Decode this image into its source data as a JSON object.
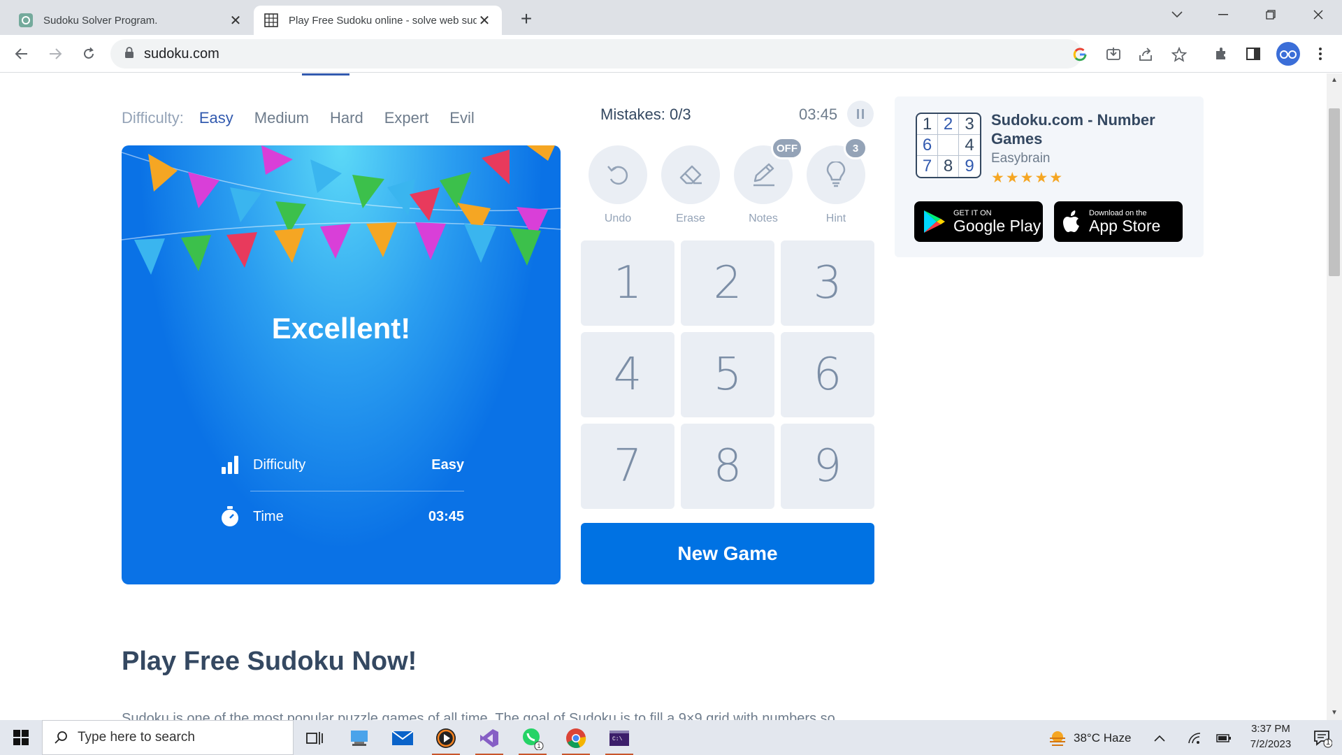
{
  "browser": {
    "tabs": [
      {
        "title": "Sudoku Solver Program.",
        "active": false
      },
      {
        "title": "Play Free Sudoku online - solve web sudoku puzzles",
        "active": true
      }
    ],
    "url": "sudoku.com"
  },
  "game": {
    "difficulty_label": "Difficulty:",
    "difficulty_options": [
      "Easy",
      "Medium",
      "Hard",
      "Expert",
      "Evil"
    ],
    "active_difficulty": "Easy",
    "mistakes": "Mistakes: 0/3",
    "timer": "03:45",
    "result": {
      "title": "Excellent!",
      "stats": [
        {
          "label": "Difficulty",
          "value": "Easy"
        },
        {
          "label": "Time",
          "value": "03:45"
        }
      ]
    },
    "tools": [
      {
        "label": "Undo",
        "badge": ""
      },
      {
        "label": "Erase",
        "badge": ""
      },
      {
        "label": "Notes",
        "badge": "OFF"
      },
      {
        "label": "Hint",
        "badge": "3"
      }
    ],
    "numbers": [
      "1",
      "2",
      "3",
      "4",
      "5",
      "6",
      "7",
      "8",
      "9"
    ],
    "new_game_label": "New Game"
  },
  "promo": {
    "grid": [
      "1",
      "2",
      "3",
      "6",
      "",
      "4",
      "7",
      "8",
      "9"
    ],
    "title": "Sudoku.com - Number Games",
    "developer": "Easybrain",
    "rating": 4.5,
    "stars": "★★★★★",
    "google_play": {
      "small": "GET IT ON",
      "big": "Google Play"
    },
    "app_store": {
      "small": "Download on the",
      "big": "App Store"
    }
  },
  "content": {
    "heading": "Play Free Sudoku Now!",
    "intro": "Sudoku is one of the most popular puzzle games of all time. The goal of Sudoku is to fill a 9×9 grid with numbers so"
  },
  "taskbar": {
    "search_placeholder": "Type here to search",
    "weather": "38°C  Haze",
    "time": "3:37 PM",
    "date": "7/2/2023",
    "notification_count": "1"
  },
  "colors": {
    "accent": "#325aaf",
    "button_blue": "#0072e3",
    "key_bg": "#eaeef4"
  }
}
